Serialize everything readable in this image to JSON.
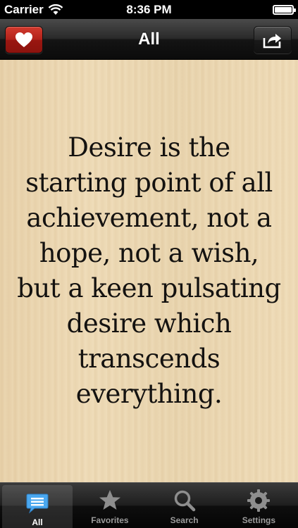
{
  "status_bar": {
    "carrier": "Carrier",
    "time": "8:36 PM"
  },
  "nav": {
    "title": "All"
  },
  "quote": {
    "text": "Desire is the starting point of all achievement, not a hope, not a wish, but a keen pulsating desire which transcends everything."
  },
  "tabs": [
    {
      "label": "All",
      "icon": "chat-bubble-icon",
      "active": true
    },
    {
      "label": "Favorites",
      "icon": "star-icon",
      "active": false
    },
    {
      "label": "Search",
      "icon": "magnifier-icon",
      "active": false
    },
    {
      "label": "Settings",
      "icon": "gear-icon",
      "active": false
    }
  ],
  "colors": {
    "favorite_button": "#b2221a",
    "active_tab_icon": "#4aa8f0"
  }
}
